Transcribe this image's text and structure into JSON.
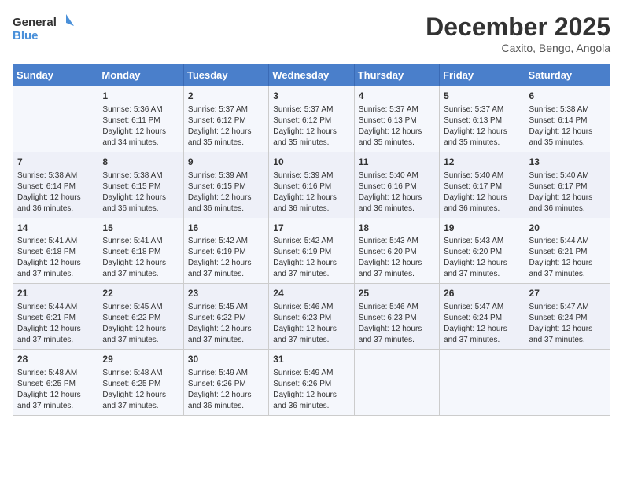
{
  "header": {
    "logo": {
      "text1": "General",
      "text2": "Blue"
    },
    "title": "December 2025",
    "location": "Caxito, Bengo, Angola"
  },
  "days_of_week": [
    "Sunday",
    "Monday",
    "Tuesday",
    "Wednesday",
    "Thursday",
    "Friday",
    "Saturday"
  ],
  "weeks": [
    [
      {
        "day": "",
        "sunrise": "",
        "sunset": "",
        "daylight": ""
      },
      {
        "day": "1",
        "sunrise": "Sunrise: 5:36 AM",
        "sunset": "Sunset: 6:11 PM",
        "daylight": "Daylight: 12 hours and 34 minutes."
      },
      {
        "day": "2",
        "sunrise": "Sunrise: 5:37 AM",
        "sunset": "Sunset: 6:12 PM",
        "daylight": "Daylight: 12 hours and 35 minutes."
      },
      {
        "day": "3",
        "sunrise": "Sunrise: 5:37 AM",
        "sunset": "Sunset: 6:12 PM",
        "daylight": "Daylight: 12 hours and 35 minutes."
      },
      {
        "day": "4",
        "sunrise": "Sunrise: 5:37 AM",
        "sunset": "Sunset: 6:13 PM",
        "daylight": "Daylight: 12 hours and 35 minutes."
      },
      {
        "day": "5",
        "sunrise": "Sunrise: 5:37 AM",
        "sunset": "Sunset: 6:13 PM",
        "daylight": "Daylight: 12 hours and 35 minutes."
      },
      {
        "day": "6",
        "sunrise": "Sunrise: 5:38 AM",
        "sunset": "Sunset: 6:14 PM",
        "daylight": "Daylight: 12 hours and 35 minutes."
      }
    ],
    [
      {
        "day": "7",
        "sunrise": "Sunrise: 5:38 AM",
        "sunset": "Sunset: 6:14 PM",
        "daylight": "Daylight: 12 hours and 36 minutes."
      },
      {
        "day": "8",
        "sunrise": "Sunrise: 5:38 AM",
        "sunset": "Sunset: 6:15 PM",
        "daylight": "Daylight: 12 hours and 36 minutes."
      },
      {
        "day": "9",
        "sunrise": "Sunrise: 5:39 AM",
        "sunset": "Sunset: 6:15 PM",
        "daylight": "Daylight: 12 hours and 36 minutes."
      },
      {
        "day": "10",
        "sunrise": "Sunrise: 5:39 AM",
        "sunset": "Sunset: 6:16 PM",
        "daylight": "Daylight: 12 hours and 36 minutes."
      },
      {
        "day": "11",
        "sunrise": "Sunrise: 5:40 AM",
        "sunset": "Sunset: 6:16 PM",
        "daylight": "Daylight: 12 hours and 36 minutes."
      },
      {
        "day": "12",
        "sunrise": "Sunrise: 5:40 AM",
        "sunset": "Sunset: 6:17 PM",
        "daylight": "Daylight: 12 hours and 36 minutes."
      },
      {
        "day": "13",
        "sunrise": "Sunrise: 5:40 AM",
        "sunset": "Sunset: 6:17 PM",
        "daylight": "Daylight: 12 hours and 36 minutes."
      }
    ],
    [
      {
        "day": "14",
        "sunrise": "Sunrise: 5:41 AM",
        "sunset": "Sunset: 6:18 PM",
        "daylight": "Daylight: 12 hours and 37 minutes."
      },
      {
        "day": "15",
        "sunrise": "Sunrise: 5:41 AM",
        "sunset": "Sunset: 6:18 PM",
        "daylight": "Daylight: 12 hours and 37 minutes."
      },
      {
        "day": "16",
        "sunrise": "Sunrise: 5:42 AM",
        "sunset": "Sunset: 6:19 PM",
        "daylight": "Daylight: 12 hours and 37 minutes."
      },
      {
        "day": "17",
        "sunrise": "Sunrise: 5:42 AM",
        "sunset": "Sunset: 6:19 PM",
        "daylight": "Daylight: 12 hours and 37 minutes."
      },
      {
        "day": "18",
        "sunrise": "Sunrise: 5:43 AM",
        "sunset": "Sunset: 6:20 PM",
        "daylight": "Daylight: 12 hours and 37 minutes."
      },
      {
        "day": "19",
        "sunrise": "Sunrise: 5:43 AM",
        "sunset": "Sunset: 6:20 PM",
        "daylight": "Daylight: 12 hours and 37 minutes."
      },
      {
        "day": "20",
        "sunrise": "Sunrise: 5:44 AM",
        "sunset": "Sunset: 6:21 PM",
        "daylight": "Daylight: 12 hours and 37 minutes."
      }
    ],
    [
      {
        "day": "21",
        "sunrise": "Sunrise: 5:44 AM",
        "sunset": "Sunset: 6:21 PM",
        "daylight": "Daylight: 12 hours and 37 minutes."
      },
      {
        "day": "22",
        "sunrise": "Sunrise: 5:45 AM",
        "sunset": "Sunset: 6:22 PM",
        "daylight": "Daylight: 12 hours and 37 minutes."
      },
      {
        "day": "23",
        "sunrise": "Sunrise: 5:45 AM",
        "sunset": "Sunset: 6:22 PM",
        "daylight": "Daylight: 12 hours and 37 minutes."
      },
      {
        "day": "24",
        "sunrise": "Sunrise: 5:46 AM",
        "sunset": "Sunset: 6:23 PM",
        "daylight": "Daylight: 12 hours and 37 minutes."
      },
      {
        "day": "25",
        "sunrise": "Sunrise: 5:46 AM",
        "sunset": "Sunset: 6:23 PM",
        "daylight": "Daylight: 12 hours and 37 minutes."
      },
      {
        "day": "26",
        "sunrise": "Sunrise: 5:47 AM",
        "sunset": "Sunset: 6:24 PM",
        "daylight": "Daylight: 12 hours and 37 minutes."
      },
      {
        "day": "27",
        "sunrise": "Sunrise: 5:47 AM",
        "sunset": "Sunset: 6:24 PM",
        "daylight": "Daylight: 12 hours and 37 minutes."
      }
    ],
    [
      {
        "day": "28",
        "sunrise": "Sunrise: 5:48 AM",
        "sunset": "Sunset: 6:25 PM",
        "daylight": "Daylight: 12 hours and 37 minutes."
      },
      {
        "day": "29",
        "sunrise": "Sunrise: 5:48 AM",
        "sunset": "Sunset: 6:25 PM",
        "daylight": "Daylight: 12 hours and 37 minutes."
      },
      {
        "day": "30",
        "sunrise": "Sunrise: 5:49 AM",
        "sunset": "Sunset: 6:26 PM",
        "daylight": "Daylight: 12 hours and 36 minutes."
      },
      {
        "day": "31",
        "sunrise": "Sunrise: 5:49 AM",
        "sunset": "Sunset: 6:26 PM",
        "daylight": "Daylight: 12 hours and 36 minutes."
      },
      {
        "day": "",
        "sunrise": "",
        "sunset": "",
        "daylight": ""
      },
      {
        "day": "",
        "sunrise": "",
        "sunset": "",
        "daylight": ""
      },
      {
        "day": "",
        "sunrise": "",
        "sunset": "",
        "daylight": ""
      }
    ]
  ]
}
